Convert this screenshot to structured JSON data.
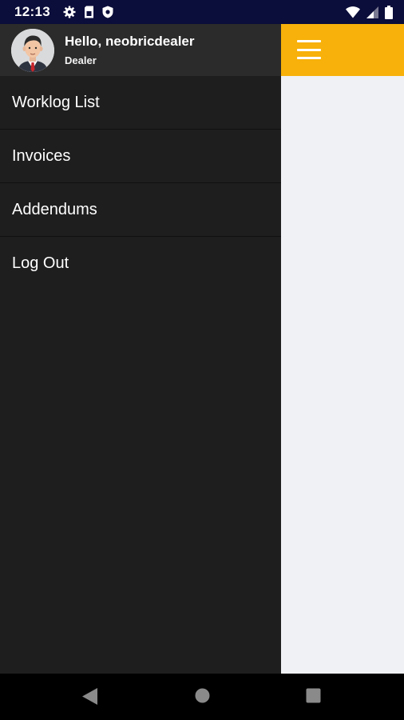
{
  "status_bar": {
    "time": "12:13",
    "left_icons": [
      "gear-icon",
      "sim-card-icon",
      "shield-icon"
    ],
    "right_icons": [
      "wifi-icon",
      "signal-icon",
      "battery-icon"
    ]
  },
  "drawer": {
    "user": {
      "greeting": "Hello, neobricdealer",
      "role": "Dealer"
    },
    "items": [
      {
        "label": "Worklog List"
      },
      {
        "label": "Invoices"
      },
      {
        "label": "Addendums"
      },
      {
        "label": "Log Out"
      }
    ]
  },
  "toolbar": {
    "menu_icon": "hamburger-menu-icon"
  },
  "nav_bar": {
    "buttons": [
      "back-icon",
      "home-icon",
      "recents-icon"
    ]
  },
  "colors": {
    "status_bar": "#0b0d3a",
    "accent": "#f7b10a",
    "drawer_bg": "#1e1e1e",
    "drawer_header_bg": "#2b2b2b",
    "content_bg": "#f0f1f5"
  }
}
